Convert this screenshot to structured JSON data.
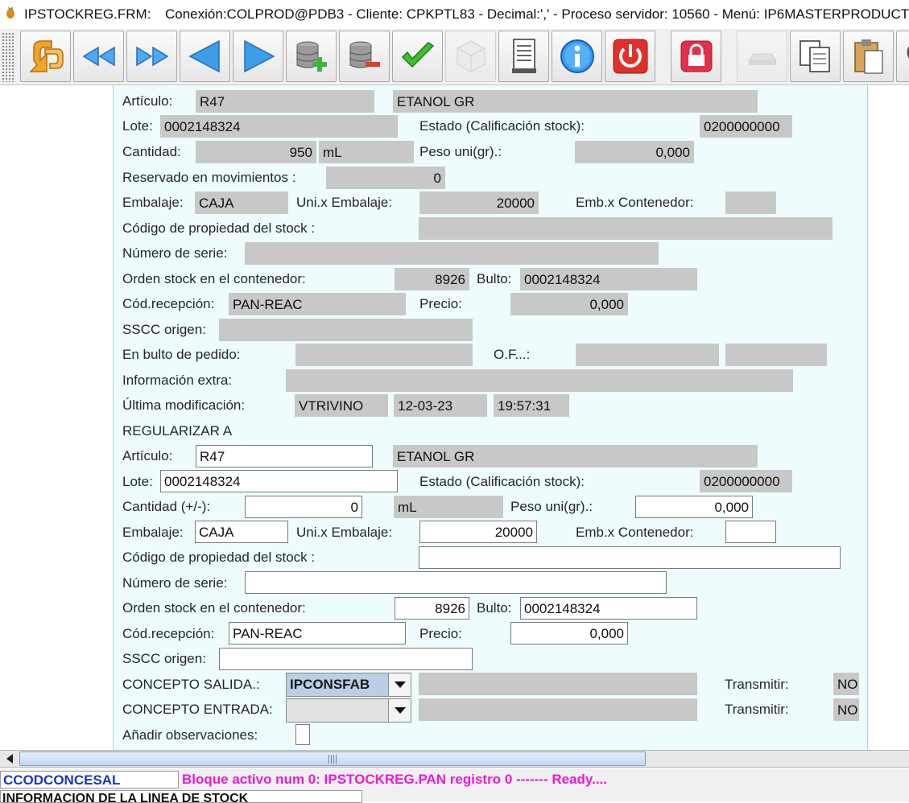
{
  "window": {
    "form_name": "IPSTOCKREG.FRM:",
    "title_info": "Conexión:COLPROD@PDB3 - Cliente: CPKPTL83 - Decimal:',' - Proceso servidor: 10560 - Menú: IP6MASTERPRODUCT"
  },
  "toolbar": {
    "buttons": [
      {
        "icon": "exit-arrow-icon"
      },
      {
        "icon": "first-record-icon"
      },
      {
        "icon": "last-record-icon"
      },
      {
        "icon": "previous-record-icon"
      },
      {
        "icon": "next-record-icon"
      },
      {
        "icon": "insert-record-icon"
      },
      {
        "icon": "delete-record-icon"
      },
      {
        "icon": "accept-checkmark-icon"
      },
      {
        "icon": "cube-icon",
        "disabled": true
      },
      {
        "icon": "document-icon"
      },
      {
        "icon": "info-icon"
      },
      {
        "icon": "power-icon"
      },
      {
        "icon": "lock-icon"
      },
      {
        "icon": "stamp-icon",
        "disabled": true
      },
      {
        "icon": "copy-icon"
      },
      {
        "icon": "paste-icon"
      },
      {
        "icon": "search-icon"
      }
    ]
  },
  "current": {
    "articulo_label": "Artículo:",
    "articulo_code": "R47",
    "articulo_desc": "ETANOL GR",
    "lote_label": "Lote:",
    "lote": "0002148324",
    "estado_label": "Estado (Calificación stock):",
    "estado": "0200000000",
    "cantidad_label": "Cantidad:",
    "cantidad": "950",
    "unidad": "mL",
    "peso_label": "Peso uni(gr).:",
    "peso": "0,000",
    "reservado_label": "Reservado en movimientos :",
    "reservado": "0",
    "embalaje_label": "Embalaje:",
    "embalaje": "CAJA",
    "uni_emb_label": "Uni.x Embalaje:",
    "uni_emb": "20000",
    "emb_cont_label": "Emb.x Contenedor:",
    "emb_cont": "",
    "codprop_label": "Código de propiedad del stock :",
    "codprop": "",
    "serie_label": "Número de serie:",
    "serie": "",
    "orden_label": "Orden stock en el contenedor:",
    "orden": "8926",
    "bulto_label": "Bulto:",
    "bulto": "0002148324",
    "codrec_label": "Cód.recepción:",
    "codrec": "PAN-REAC",
    "precio_label": "Precio:",
    "precio": "0,000",
    "sscc_label": "SSCC origen:",
    "sscc": "",
    "bulto_pedido_label": "En bulto de pedido:",
    "bulto_pedido": "",
    "of_label": "O.F...:",
    "of1": "",
    "of2": "",
    "info_extra_label": "Información extra:",
    "info_extra": "",
    "ultima_label": "Última modificación:",
    "ultima_user": "VTRIVINO",
    "ultima_date": "12-03-23",
    "ultima_time": "19:57:31"
  },
  "regularizar": {
    "section_title": "REGULARIZAR A",
    "articulo_label": "Artículo:",
    "articulo_code": "R47",
    "articulo_desc": "ETANOL GR",
    "lote_label": "Lote:",
    "lote": "0002148324",
    "estado_label": "Estado (Calificación stock):",
    "estado": "0200000000",
    "cantidad_label": "Cantidad (+/-):",
    "cantidad": "0",
    "unidad": "mL",
    "peso_label": "Peso uni(gr).:",
    "peso": "0,000",
    "embalaje_label": "Embalaje:",
    "embalaje": "CAJA",
    "uni_emb_label": "Uni.x Embalaje:",
    "uni_emb": "20000",
    "emb_cont_label": "Emb.x Contenedor:",
    "emb_cont": "",
    "codprop_label": "Código de propiedad del stock :",
    "codprop": "",
    "serie_label": "Número de serie:",
    "serie": "",
    "orden_label": "Orden stock en el contenedor:",
    "orden": "8926",
    "bulto_label": "Bulto:",
    "bulto": "0002148324",
    "codrec_label": "Cód.recepción:",
    "codrec": "PAN-REAC",
    "precio_label": "Precio:",
    "precio": "0,000",
    "sscc_label": "SSCC origen:",
    "sscc": "",
    "concepto_salida_label": "CONCEPTO SALIDA.:",
    "concepto_salida": "IPCONSFAB",
    "concepto_salida_desc": "",
    "transmitir_label": "Transmitir:",
    "transmitir_salida": "NO",
    "concepto_entrada_label": "CONCEPTO ENTRADA:",
    "concepto_entrada": "",
    "concepto_entrada_desc": "",
    "transmitir_entrada": "NO",
    "observaciones_label": "Añadir observaciones:"
  },
  "statusbar": {
    "field_name": "CCODCONCESAL",
    "message": "Bloque activo num 0: IPSTOCKREG.PAN  registro 0 ------- Ready....",
    "info": "INFORMACION DE LA LINEA DE STOCK"
  },
  "colors": {
    "panel_bg": "#eefcfd",
    "readonly_bg": "#c8c8c8",
    "status_field": "#1a35c8",
    "status_message": "#e81ad6"
  }
}
